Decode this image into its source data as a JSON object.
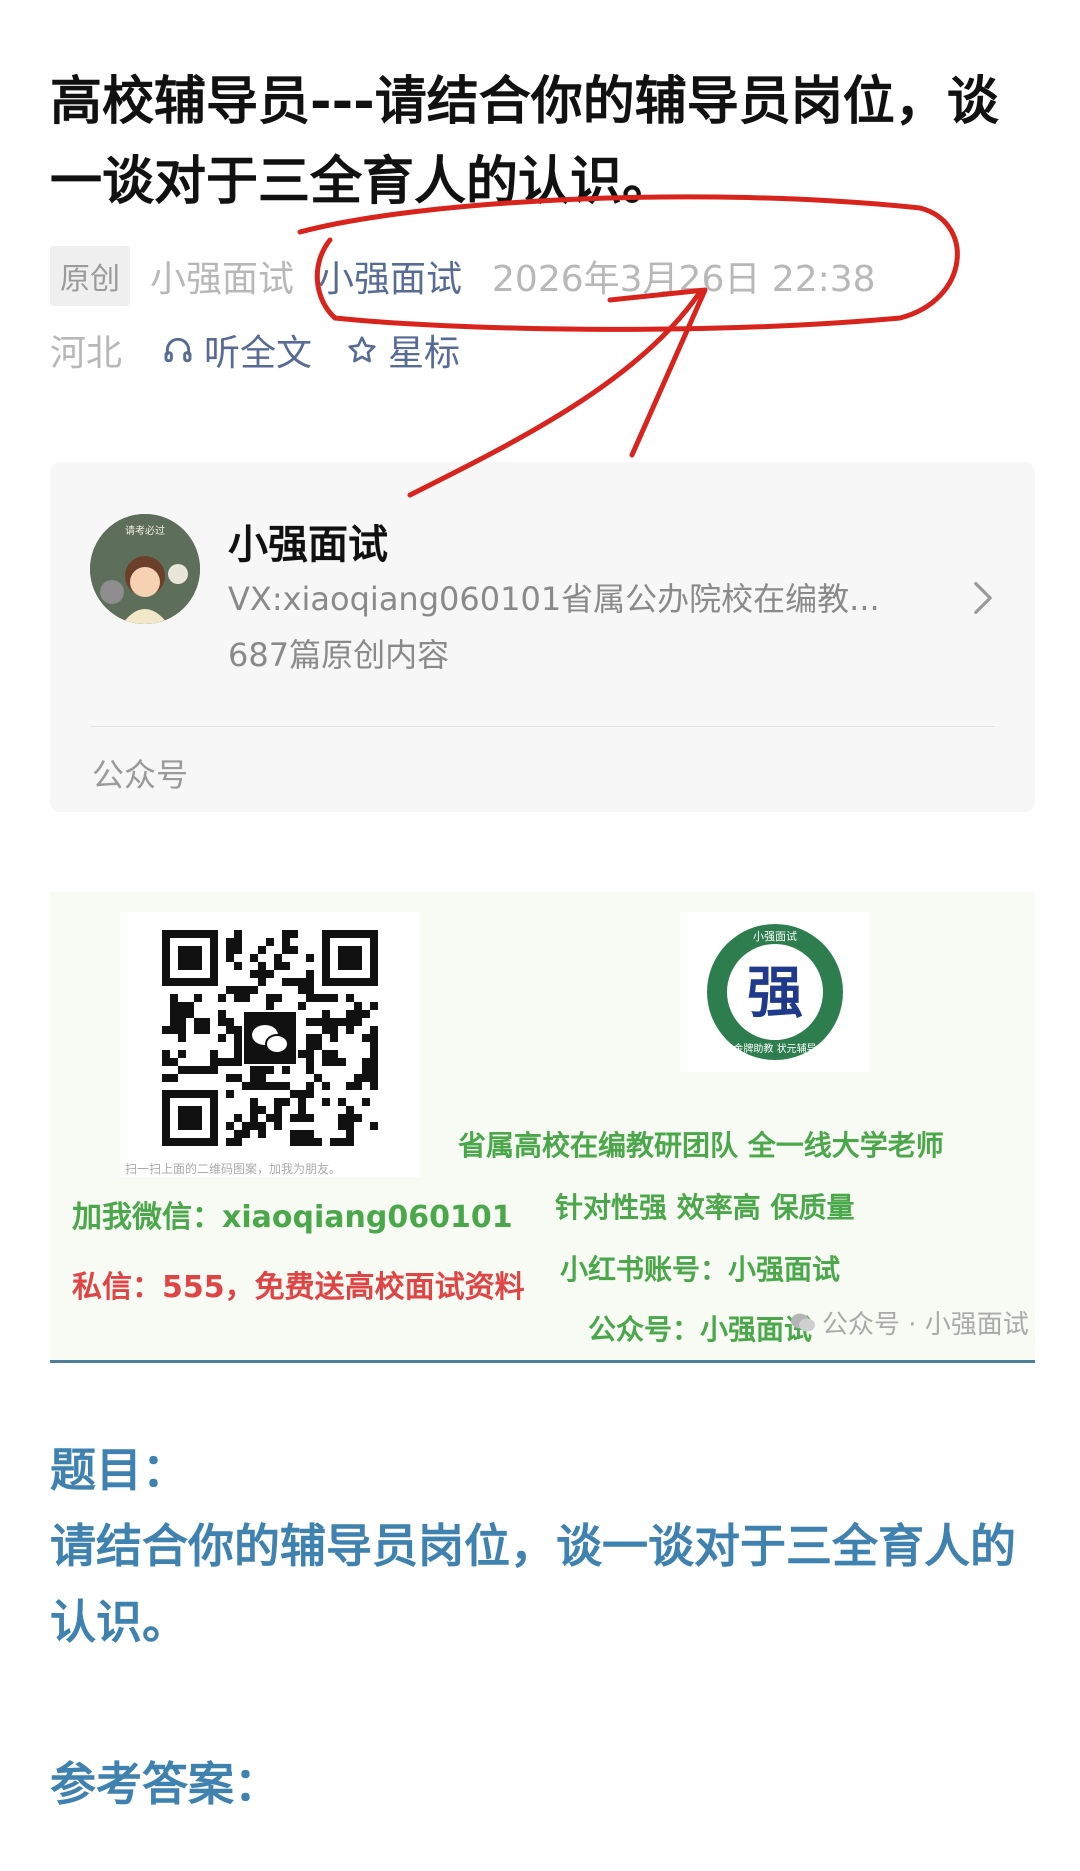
{
  "article": {
    "title": "高校辅导员---请结合你的辅导员岗位，谈一谈对于三全育人的认识。",
    "tag_original": "原创",
    "author_plain": "小强面试",
    "author_link": "小强面试",
    "date": "2026年3月26日 22:38",
    "location": "河北",
    "listen_label": "听全文",
    "star_label": "星标"
  },
  "profile_card": {
    "name": "小强面试",
    "description": "VX:xiaoqiang060101省属公办院校在编教...",
    "original_count": "687篇原创内容",
    "type_label": "公众号",
    "avatar_text": "请考必过"
  },
  "banner": {
    "qr_caption": "扫一扫上面的二维码图案，加我为朋友。",
    "wechat_line": "加我微信：xiaoqiang060101",
    "gift_line": "私信：555，免费送高校面试资料",
    "logo_char": "强",
    "logo_ring_top": "小强面试",
    "logo_ring_bottom": "金牌助教 状元辅导",
    "team_line": "省属高校在编教研团队  全一线大学老师",
    "feature_line": "针对性强 效率高 保质量",
    "xhs_line": "小红书账号：小强面试",
    "gzh_line": "公众号：小强面试",
    "watermark": "公众号 · 小强面试"
  },
  "content": {
    "question_heading": "题目：",
    "question_body": "请结合你的辅导员岗位，谈一谈对于三全育人的认识。",
    "answer_heading": "参考答案："
  },
  "colors": {
    "link_blue": "#576b95",
    "heading_blue": "#3f82b0",
    "banner_green": "#4aa84a",
    "banner_red": "#e04545",
    "annotation_red": "#d8241c"
  },
  "icons": [
    "headphones-icon",
    "star-outline-icon",
    "chevron-right-icon",
    "wechat-icon"
  ]
}
